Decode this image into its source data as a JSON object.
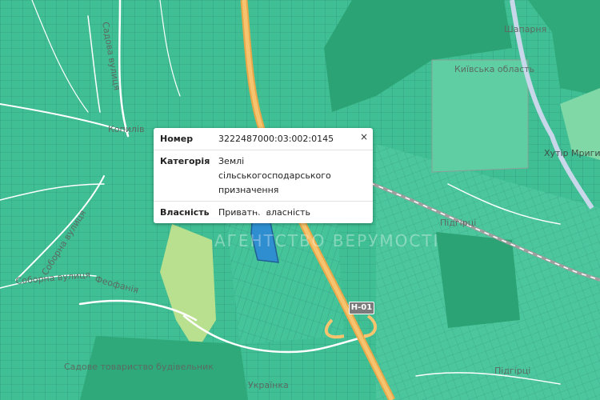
{
  "popup": {
    "rows": [
      {
        "key": "Номер",
        "value": "3222487000:03:002:0145"
      },
      {
        "key": "Категорія",
        "value": "Землі сільськогосподарського призначення"
      },
      {
        "key": "Власність",
        "value": "Приватна власність"
      }
    ],
    "close_label": "×"
  },
  "road_badge": "Н-01",
  "labels": {
    "kyivska_oblast": "Київська область",
    "khutir": "Хутір Мриги",
    "shapar": "Шапарня",
    "pidhirtsi": "Підгірці",
    "pidhirtsi2": "Підгірці",
    "watermark": "АГЕНТСТВО ВЕРУМОСТІ",
    "street_left": "Соборна вулиця",
    "street_left2": "Соборна вулиця",
    "street_top": "Садова вулиця",
    "feofania": "Феофанія",
    "budiv": "Садове товариство будівельник",
    "kopylov": "Копилів",
    "ukrainka": "Українка"
  },
  "colors": {
    "map_base": "#3fbf93",
    "forest": "#2ba374",
    "parcel_line": "#2f8f7a",
    "selected_parcel": "#2e8ecf",
    "highway": "#f0b25a",
    "railway": "#9e9e9e"
  }
}
